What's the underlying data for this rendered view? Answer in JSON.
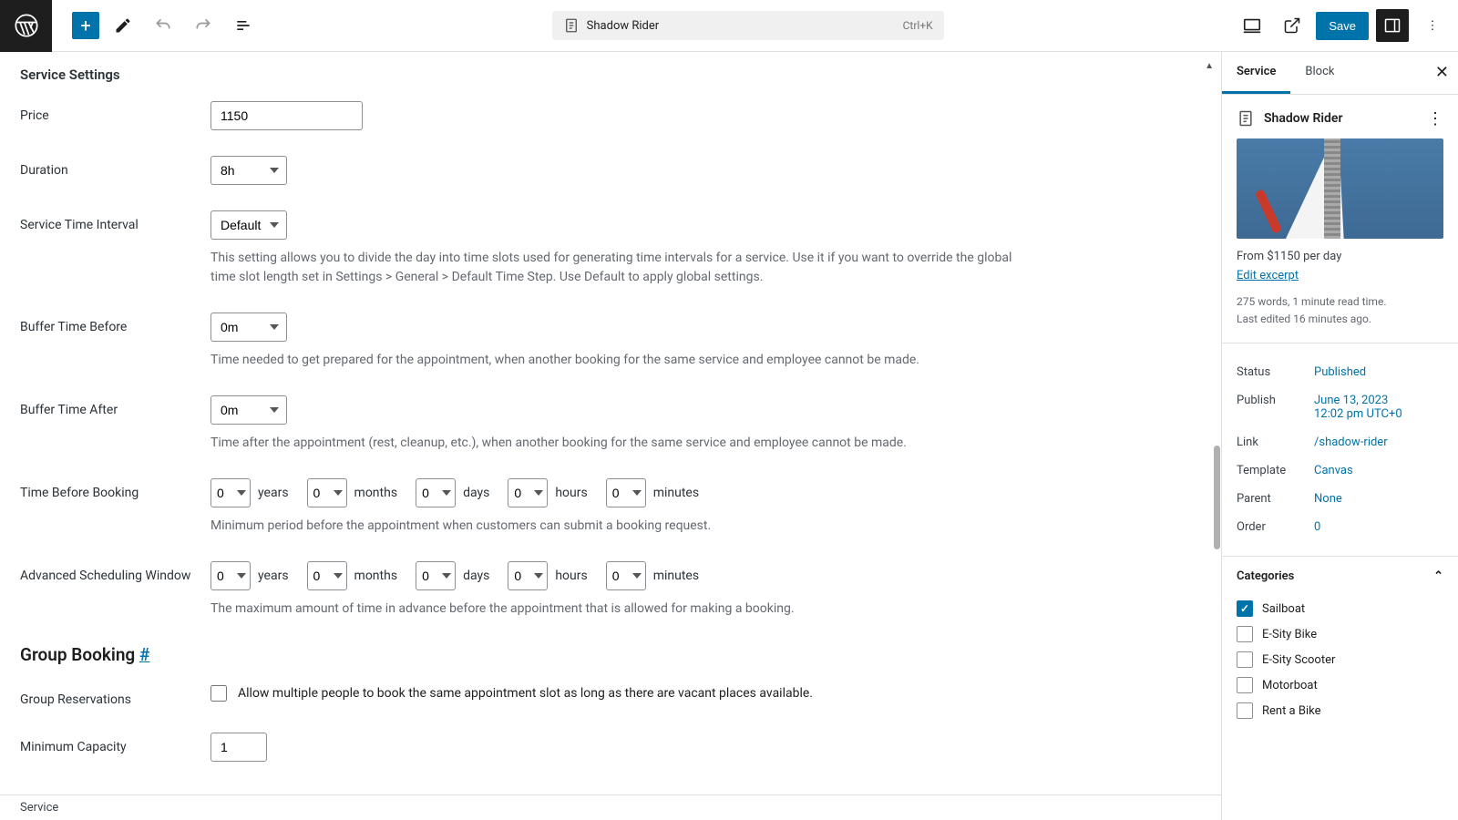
{
  "topbar": {
    "title": "Shadow Rider",
    "shortcut": "Ctrl+K",
    "save": "Save"
  },
  "main": {
    "section_title": "Service Settings",
    "price": {
      "label": "Price",
      "value": "1150"
    },
    "duration": {
      "label": "Duration",
      "value": "8h"
    },
    "interval": {
      "label": "Service Time Interval",
      "value": "Default",
      "help": "This setting allows you to divide the day into time slots used for generating time intervals for a service. Use it if you want to override the global time slot length set in Settings > General > Default Time Step. Use Default to apply global settings."
    },
    "buffer_before": {
      "label": "Buffer Time Before",
      "value": "0m",
      "help": "Time needed to get prepared for the appointment, when another booking for the same service and employee cannot be made."
    },
    "buffer_after": {
      "label": "Buffer Time After",
      "value": "0m",
      "help": "Time after the appointment (rest, cleanup, etc.), when another booking for the same service and employee cannot be made."
    },
    "time_before_booking": {
      "label": "Time Before Booking",
      "units": {
        "years": "years",
        "months": "months",
        "days": "days",
        "hours": "hours",
        "minutes": "minutes"
      },
      "values": {
        "years": "0",
        "months": "0",
        "days": "0",
        "hours": "0",
        "minutes": "0"
      },
      "help": "Minimum period before the appointment when customers can submit a booking request."
    },
    "advance_window": {
      "label": "Advanced Scheduling Window",
      "values": {
        "years": "0",
        "months": "0",
        "days": "0",
        "hours": "0",
        "minutes": "0"
      },
      "help": "The maximum amount of time in advance before the appointment that is allowed for making a booking."
    },
    "group_booking": {
      "title": "Group Booking ",
      "anchor": "#",
      "reservations_label": "Group Reservations",
      "reservations_text": "Allow multiple people to book the same appointment slot as long as there are vacant places available.",
      "min_cap_label": "Minimum Capacity",
      "min_cap_value": "1"
    },
    "footer_tab": "Service"
  },
  "sidebar": {
    "tabs": {
      "service": "Service",
      "block": "Block"
    },
    "post_title": "Shadow Rider",
    "excerpt": "From $1150 per day",
    "edit_excerpt": "Edit excerpt",
    "meta_words": "275 words, 1 minute read time.",
    "meta_edited": "Last edited 16 minutes ago.",
    "rows": {
      "status": {
        "k": "Status",
        "v": "Published"
      },
      "publish": {
        "k": "Publish",
        "v1": "June 13, 2023",
        "v2": "12:02 pm UTC+0"
      },
      "link": {
        "k": "Link",
        "v": "/shadow-rider"
      },
      "template": {
        "k": "Template",
        "v": "Canvas"
      },
      "parent": {
        "k": "Parent",
        "v": "None"
      },
      "order": {
        "k": "Order",
        "v": "0"
      }
    },
    "categories": {
      "title": "Categories",
      "items": [
        {
          "label": "Sailboat",
          "checked": true
        },
        {
          "label": "E-Sity Bike",
          "checked": false
        },
        {
          "label": "E-Sity Scooter",
          "checked": false
        },
        {
          "label": "Motorboat",
          "checked": false
        },
        {
          "label": "Rent a Bike",
          "checked": false
        }
      ]
    }
  }
}
